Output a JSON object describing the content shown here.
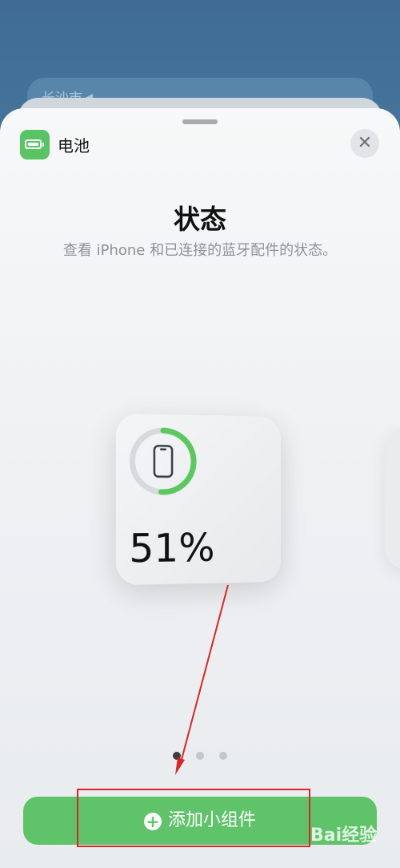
{
  "background": {
    "card_text": "长沙市◀"
  },
  "sheet": {
    "app_name": "电池",
    "close_glyph": "✕",
    "title": "状态",
    "subtitle": "查看 iPhone 和已连接的蓝牙配件的状态。"
  },
  "widget": {
    "battery_percent_label": "51%",
    "battery_fraction": 0.51,
    "ring_color": "#5ac85f",
    "icon": "iphone-icon"
  },
  "pager": {
    "count": 3,
    "active_index": 0
  },
  "add_button": {
    "label": "添加小组件",
    "icon": "plus-circle-icon",
    "color": "#5fc36a"
  },
  "watermark": {
    "text": "Bai经验"
  },
  "annotation": {
    "color": "#e02424"
  }
}
